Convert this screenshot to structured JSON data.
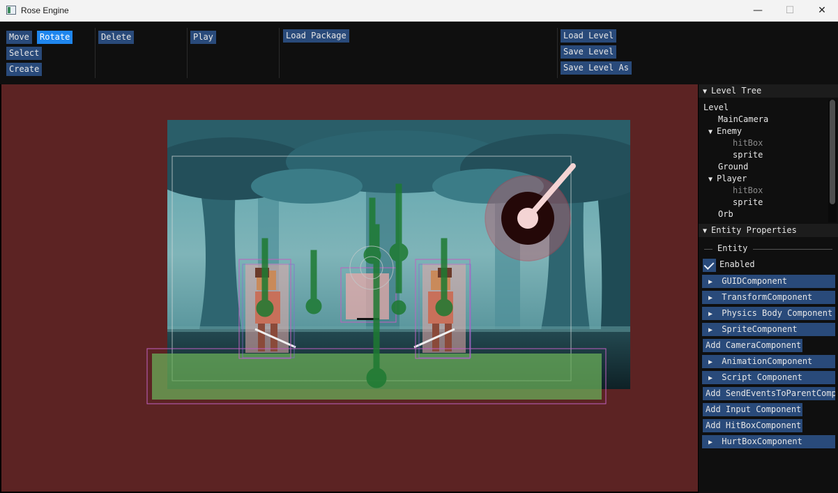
{
  "window": {
    "title": "Rose Engine",
    "minimize": "—",
    "maximize": "☐",
    "close": "✕"
  },
  "toolbar": {
    "move": "Move",
    "rotate": "Rotate",
    "select": "Select",
    "create": "Create",
    "delete": "Delete",
    "play": "Play",
    "load_package": "Load Package",
    "load_level": "Load Level",
    "save_level": "Save Level",
    "save_level_as": "Save Level As"
  },
  "level_tree": {
    "header": "Level Tree",
    "items": [
      {
        "label": "Level"
      },
      {
        "label": "MainCamera"
      },
      {
        "label": "Enemy"
      },
      {
        "label": "hitBox"
      },
      {
        "label": "sprite"
      },
      {
        "label": "Ground"
      },
      {
        "label": "Player"
      },
      {
        "label": "hitBox"
      },
      {
        "label": "sprite"
      },
      {
        "label": "Orb"
      }
    ]
  },
  "entity_properties": {
    "header": "Entity Properties",
    "section": "Entity",
    "enabled_label": "Enabled",
    "enabled": true,
    "components": [
      "GUIDComponent",
      "TransformComponent",
      "Physics Body Component",
      "SpriteComponent",
      "Add CameraComponent",
      "AnimationComponent",
      "Script Component",
      "Add SendEventsToParentComponent",
      "Add Input Component",
      "Add HitBoxComponent",
      "HurtBoxComponent"
    ]
  },
  "colors": {
    "viewport_bg": "#5c2323",
    "button": "#294a7a",
    "button_active": "#1f86ee",
    "gizmo_green": "#1e7a32",
    "selection": "#c060c0"
  }
}
